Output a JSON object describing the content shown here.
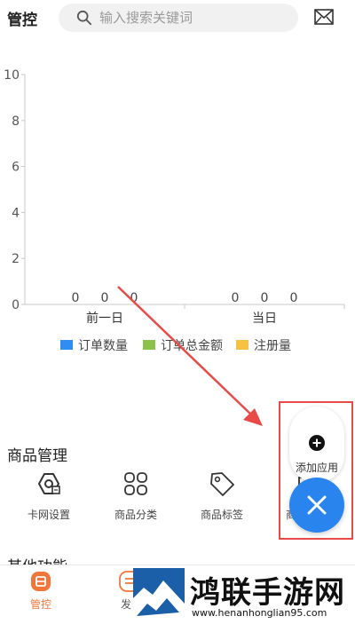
{
  "header": {
    "title": "管控",
    "search_placeholder": "输入搜索关键词"
  },
  "chart_data": {
    "type": "bar",
    "categories": [
      "前一日",
      "当日"
    ],
    "series": [
      {
        "name": "订单数量",
        "values": [
          0,
          0
        ],
        "color": "#2f8ef0"
      },
      {
        "name": "订单总金额",
        "values": [
          0,
          0
        ],
        "color": "#8bc34a"
      },
      {
        "name": "注册量",
        "values": [
          0,
          0
        ],
        "color": "#f5c242"
      }
    ],
    "ylim": [
      0,
      10
    ],
    "yticks": [
      "0",
      "2",
      "4",
      "6",
      "8",
      "10"
    ],
    "legend": "bottom",
    "grid": false
  },
  "goods": {
    "title": "商品管理",
    "items": [
      {
        "label": "卡网设置",
        "icon": "gear-icon"
      },
      {
        "label": "商品分类",
        "icon": "grid-icon"
      },
      {
        "label": "商品标签",
        "icon": "tag-icon"
      },
      {
        "label": "商",
        "icon": "box-icon"
      }
    ]
  },
  "other": {
    "title": "其他功能"
  },
  "tabs": [
    {
      "label": "管控",
      "icon": "home-icon",
      "active": true,
      "color": "#f0763a"
    },
    {
      "label": "发",
      "icon": "publish-icon",
      "active": false,
      "color": "#f0763a"
    }
  ],
  "fab": {
    "add_label": "添加应用",
    "accent": "#2a84ee"
  },
  "annotation": {
    "color": "#e84b47"
  },
  "watermark": {
    "title": "鸿联手游网",
    "url": "www.henanhonglian95.com"
  }
}
